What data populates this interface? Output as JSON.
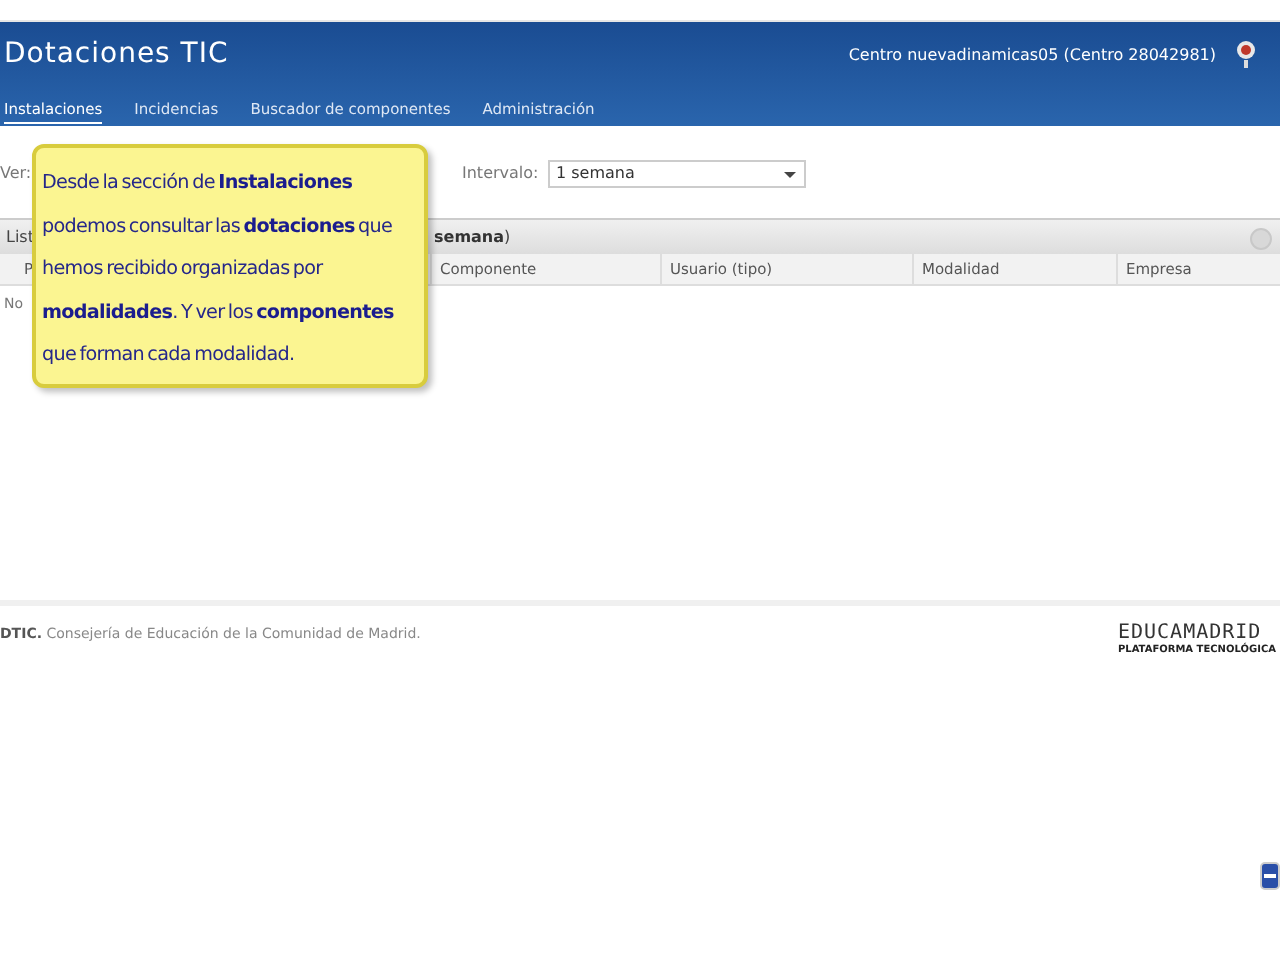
{
  "header": {
    "title": "Dotaciones TIC",
    "centre": "Centro nuevadinamicas05 (Centro 28042981)"
  },
  "nav": [
    {
      "label": "Instalaciones",
      "selected": true
    },
    {
      "label": "Incidencias",
      "selected": false
    },
    {
      "label": "Buscador de componentes",
      "selected": false
    },
    {
      "label": "Administración",
      "selected": false
    }
  ],
  "filters": {
    "ver_label": "Ver:",
    "interval_label": "Intervalo:",
    "interval_value": "1 semana"
  },
  "grid": {
    "title_start": "List",
    "title_end": "**semana**)",
    "columns": [
      "P",
      "Componente",
      "Usuario (tipo)",
      "Modalidad",
      "Empresa"
    ],
    "empty_text": "No"
  },
  "tooltip": {
    "text": "Desde la sección de **Instalaciones** podemos consultar las **dotaciones** que hemos recibido organizadas por **modalidades**. Y ver los **componentes** que forman cada modalidad."
  },
  "footer": {
    "text": "**DTIC.** Consejería de Educación de la Comunidad de Madrid.",
    "logo": "EDUCAMADRID",
    "logo_sub": "PLATAFORMA TECNOLÓGICA"
  }
}
